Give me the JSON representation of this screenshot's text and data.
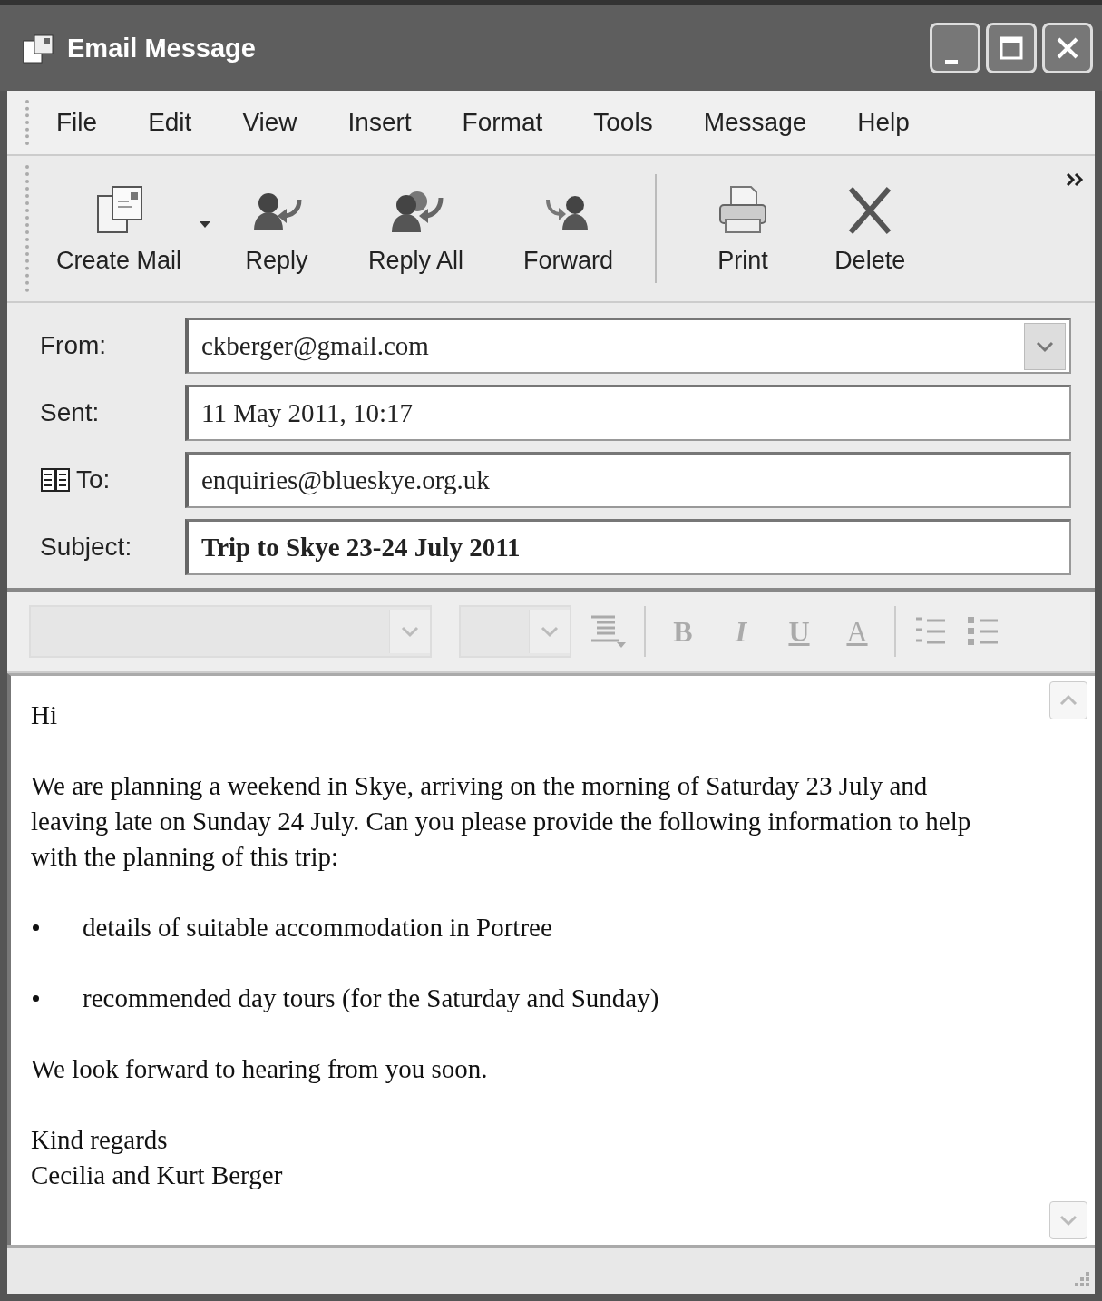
{
  "window": {
    "title": "Email Message"
  },
  "menu": [
    "File",
    "Edit",
    "View",
    "Insert",
    "Format",
    "Tools",
    "Message",
    "Help"
  ],
  "toolbar": [
    {
      "label": "Create Mail",
      "kind": "create",
      "dropdown": true
    },
    {
      "label": "Reply",
      "kind": "reply",
      "dropdown": false
    },
    {
      "label": "Reply All",
      "kind": "replyall",
      "dropdown": false
    },
    {
      "label": "Forward",
      "kind": "forward",
      "dropdown": false
    },
    {
      "label": "Print",
      "kind": "print",
      "dropdown": false
    },
    {
      "label": "Delete",
      "kind": "delete",
      "dropdown": false
    }
  ],
  "header": [
    {
      "label": "From:",
      "value": "ckberger@gmail.com",
      "kind": "dropdown"
    },
    {
      "label": "Sent:",
      "value": "11 May 2011, 10:17",
      "kind": "text"
    },
    {
      "label": "To:",
      "value": "enquiries@blueskye.org.uk",
      "kind": "address"
    },
    {
      "label": "Subject:",
      "value": "Trip to Skye 23-24 July 2011",
      "kind": "subject"
    }
  ],
  "format_buttons": [
    {
      "label": "B",
      "kind": "bold"
    },
    {
      "label": "I",
      "kind": "italic"
    },
    {
      "label": "U",
      "kind": "underline"
    },
    {
      "label": "A",
      "kind": "color"
    }
  ],
  "body": [
    {
      "kind": "paragraph",
      "text": "Hi"
    },
    {
      "kind": "paragraph",
      "text": "We are planning a weekend in Skye, arriving on the morning of Saturday 23 July and leaving late on Sunday 24 July. Can you please provide the following information to help with the planning of this trip:"
    },
    {
      "kind": "bullet",
      "text": "details of suitable accommodation in Portree"
    },
    {
      "kind": "bullet",
      "text": "recommended day tours (for the Saturday and Sunday)"
    },
    {
      "kind": "paragraph",
      "text": "We look forward to hearing from you soon."
    },
    {
      "kind": "line",
      "text": "Kind regards"
    },
    {
      "kind": "line",
      "text": "Cecilia and Kurt Berger"
    }
  ]
}
